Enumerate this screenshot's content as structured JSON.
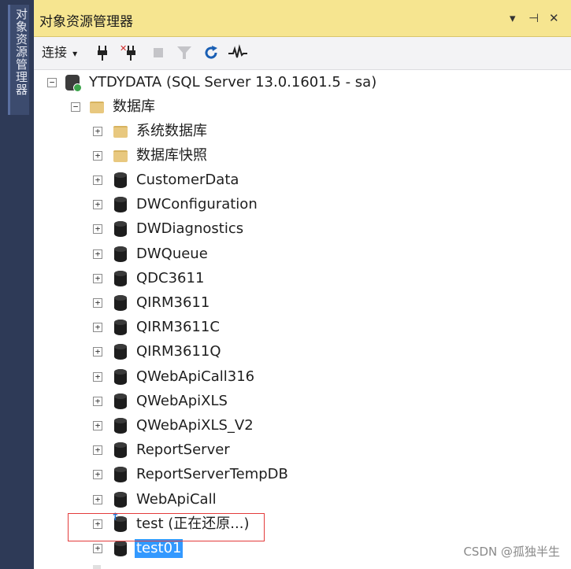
{
  "side_tab": {
    "label": "对象资源管理器"
  },
  "panel": {
    "title": "对象资源管理器",
    "title_buttons": {
      "dropdown": "▾",
      "pin": "⊣",
      "close": "✕"
    }
  },
  "toolbar": {
    "connect_label": "连接",
    "connect_arrow": "▾",
    "buttons": [
      "connect-icon",
      "disconnect-icon",
      "stop-icon",
      "filter-icon",
      "refresh-icon",
      "activity-monitor-icon"
    ]
  },
  "tree": {
    "server": "YTDYDATA (SQL Server 13.0.1601.5 - sa)",
    "databases_folder": "数据库",
    "system_databases": "系统数据库",
    "snapshots": "数据库快照",
    "databases": [
      "CustomerData",
      "DWConfiguration",
      "DWDiagnostics",
      "DWQueue",
      "QDC3611",
      "QIRM3611",
      "QIRM3611C",
      "QIRM3611Q",
      "QWebApiCall316",
      "QWebApiXLS",
      "QWebApiXLS_V2",
      "ReportServer",
      "ReportServerTempDB",
      "WebApiCall"
    ],
    "restoring_db": "test (正在还原...)",
    "selected_db": "test01"
  },
  "watermark": "CSDN @孤独半生",
  "colors": {
    "titlebar": "#f6e590",
    "side_strip": "#2e3a57",
    "selection": "#3399ff",
    "highlight_box": "#e33b3b"
  }
}
